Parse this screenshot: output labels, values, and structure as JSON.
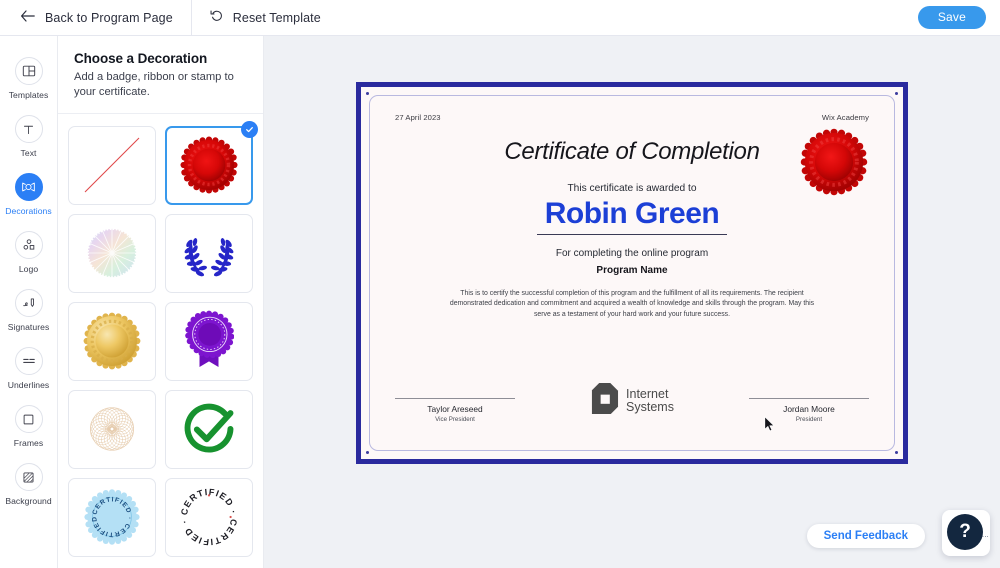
{
  "topbar": {
    "back_label": "Back to Program Page",
    "back_icon": "arrow-left-icon",
    "reset_label": "Reset Template",
    "reset_icon": "reset-circular-arrow-icon",
    "save_label": "Save",
    "save_color": "#3899ec"
  },
  "rail": {
    "active": "Decorations",
    "accent": "#2b7ff5",
    "items": [
      {
        "label": "Templates",
        "icon": "templates-layout-icon"
      },
      {
        "label": "Text",
        "icon": "text-t-icon"
      },
      {
        "label": "Decorations",
        "icon": "decoration-badge-icon"
      },
      {
        "label": "Logo",
        "icon": "logo-shapes-icon"
      },
      {
        "label": "Signatures",
        "icon": "signature-pen-icon"
      },
      {
        "label": "Underlines",
        "icon": "underline-lines-icon"
      },
      {
        "label": "Frames",
        "icon": "frame-square-icon"
      },
      {
        "label": "Background",
        "icon": "background-hatch-icon"
      }
    ]
  },
  "panel": {
    "title": "Choose a Decoration",
    "subtitle": "Add a badge, ribbon or stamp to your certificate.",
    "selected_index": 1,
    "items": [
      {
        "name": "none-option",
        "icon": "diagonal-slash-none-icon",
        "selected": false
      },
      {
        "name": "red-wax-seal",
        "icon": "red-seal-badge-icon",
        "selected": true
      },
      {
        "name": "holographic-rosette",
        "icon": "holographic-rosette-icon",
        "selected": false
      },
      {
        "name": "blue-laurel-wreath",
        "icon": "laurel-wreath-icon",
        "selected": false
      },
      {
        "name": "gold-seal",
        "icon": "gold-seal-badge-icon",
        "selected": false
      },
      {
        "name": "purple-ribbon-rosette",
        "icon": "purple-ribbon-award-icon",
        "selected": false
      },
      {
        "name": "guilloche-rosette",
        "icon": "guilloche-rosette-icon",
        "selected": false
      },
      {
        "name": "green-check-circle",
        "icon": "green-check-circle-icon",
        "selected": false
      },
      {
        "name": "blue-certified-stamp",
        "icon": "blue-certified-stamp-icon",
        "selected": false
      },
      {
        "name": "outline-certified-stamp",
        "icon": "certified-ring-text-icon",
        "selected": false
      }
    ],
    "stamp_text": "CERTIFIED"
  },
  "certificate": {
    "date": "27 April 2023",
    "organization": "Wix Academy",
    "title": "Certificate of Completion",
    "awarded_to_label": "This certificate is awarded to",
    "recipient_name": "Robin Green",
    "for_completing_label": "For completing the online program",
    "program_name": "Program Name",
    "body_text": "This is to certify the successful completion of this program and the fulfillment of all its requirements. The recipient demonstrated dedication and commitment and acquired a wealth of knowledge and skills through the program. May this serve as a testament of your hard work and your future success.",
    "seal": "red-wax-seal",
    "border_color": "#2a2a9e",
    "name_color": "#1c3fd6",
    "paper_color": "#fdf8f8",
    "signatures": [
      {
        "name": "Taylor Areseed",
        "title": "Vice President"
      },
      {
        "name": "Jordan Moore",
        "title": "President"
      }
    ],
    "logo": {
      "line1": "Internet",
      "line2": "Systems",
      "icon": "internet-systems-logo-icon"
    }
  },
  "floating": {
    "feedback_label": "Send Feedback",
    "help_label": "?",
    "help_icon": "question-mark-icon"
  }
}
